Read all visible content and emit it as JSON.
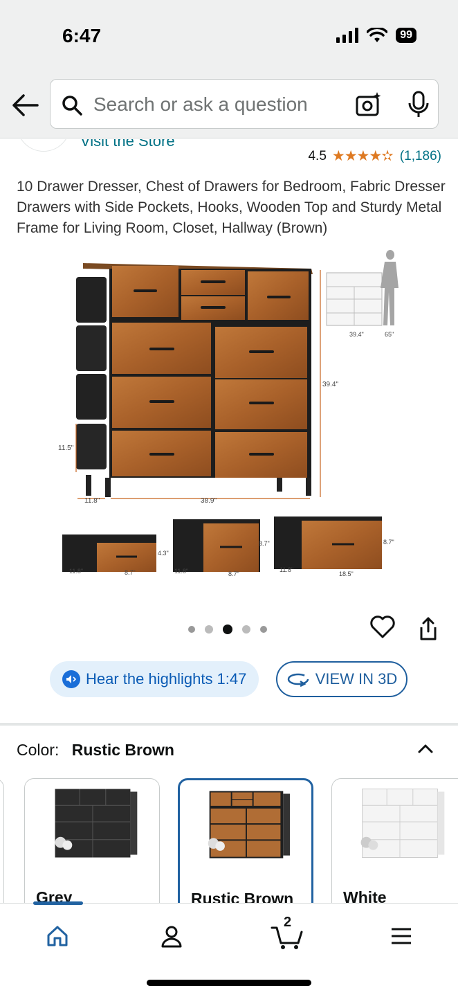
{
  "status_bar": {
    "time": "6:47",
    "battery": "99"
  },
  "search": {
    "placeholder": "Search or ask a question"
  },
  "store": {
    "visit_label": "Visit the Store"
  },
  "rating": {
    "value": "4.5",
    "stars": "★★★★✫",
    "count": "(1,186)"
  },
  "product": {
    "title": "10 Drawer Dresser, Chest of Drawers for Bedroom, Fabric Dresser Drawers with Side Pockets, Hooks, Wooden Top and Sturdy Metal Frame for Living Room, Closet, Hallway (Brown)"
  },
  "image_dims": {
    "height": "39.4\"",
    "width": "38.9\"",
    "depth": "11.8\"",
    "pocket": "11.5\"",
    "small_h": "4.3\"",
    "mid_h": "8.7\"",
    "large_h": "8.7\"",
    "small_w": "8.7\"",
    "mid_w": "8.7\"",
    "large_w": "18.5\"",
    "d1": "11.8\"",
    "d2": "11.8\"",
    "d3": "11.8\"",
    "thumb_w": "39.4\"",
    "person_h": "65\""
  },
  "carousel": {
    "total": 5,
    "active_index": 2
  },
  "actions": {
    "hear_label": "Hear the highlights 1:47",
    "view3d_label": "VIEW IN 3D"
  },
  "variants": {
    "label": "Color:",
    "selected": "Rustic Brown",
    "options": [
      {
        "label": "Grey"
      },
      {
        "label": "Rustic Brown"
      },
      {
        "label": "White"
      }
    ]
  },
  "nav": {
    "cart_count": "2"
  },
  "colors": {
    "accent_blue": "#2162a1",
    "link_teal": "#007185",
    "star_orange": "#de7921",
    "wood": "#a8642a"
  }
}
